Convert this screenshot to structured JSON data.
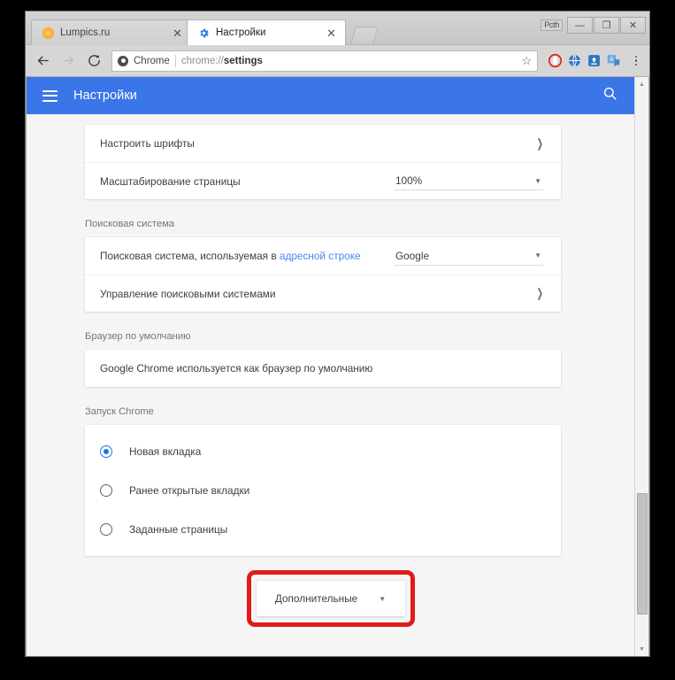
{
  "window": {
    "mini_label": "Pcth",
    "minimize": "—",
    "maximize": "❐",
    "close": "✕"
  },
  "tabs": [
    {
      "title": "Lumpics.ru",
      "close": "✕",
      "active": false
    },
    {
      "title": "Настройки",
      "close": "✕",
      "active": true
    }
  ],
  "toolbar": {
    "back": "←",
    "forward": "→",
    "reload": "⟳",
    "scheme_label": "Chrome",
    "url_prefix": "chrome://",
    "url_bold": "settings",
    "bookmark": "☆"
  },
  "appbar": {
    "title": "Настройки",
    "menu_icon": "hamburger-icon",
    "search_icon": "search-icon"
  },
  "settings": {
    "fonts_row": {
      "label": "Настроить шрифты",
      "chevron": "❯"
    },
    "zoom_row": {
      "label": "Масштабирование страницы",
      "value": "100%",
      "caret": "▼"
    },
    "search_engine": {
      "section": "Поисковая система",
      "row_label_before": "Поисковая система, используемая в ",
      "row_link": "адресной строке",
      "value": "Google",
      "caret": "▼",
      "manage_label": "Управление поисковыми системами",
      "chevron": "❯"
    },
    "default_browser": {
      "section": "Браузер по умолчанию",
      "text": "Google Chrome используется как браузер по умолчанию"
    },
    "startup": {
      "section": "Запуск Chrome",
      "options": [
        {
          "label": "Новая вкладка",
          "checked": true
        },
        {
          "label": "Ранее открытые вкладки",
          "checked": false
        },
        {
          "label": "Заданные страницы",
          "checked": false
        }
      ]
    },
    "advanced": {
      "label": "Дополнительные",
      "caret": "▼"
    }
  },
  "scrollbar": {
    "up": "▲",
    "down": "▼"
  },
  "colors": {
    "appbar_blue": "#3a76e8",
    "link_blue": "#4387f0",
    "radio_blue": "#1a73e8",
    "highlight_red": "#e01b1b"
  }
}
